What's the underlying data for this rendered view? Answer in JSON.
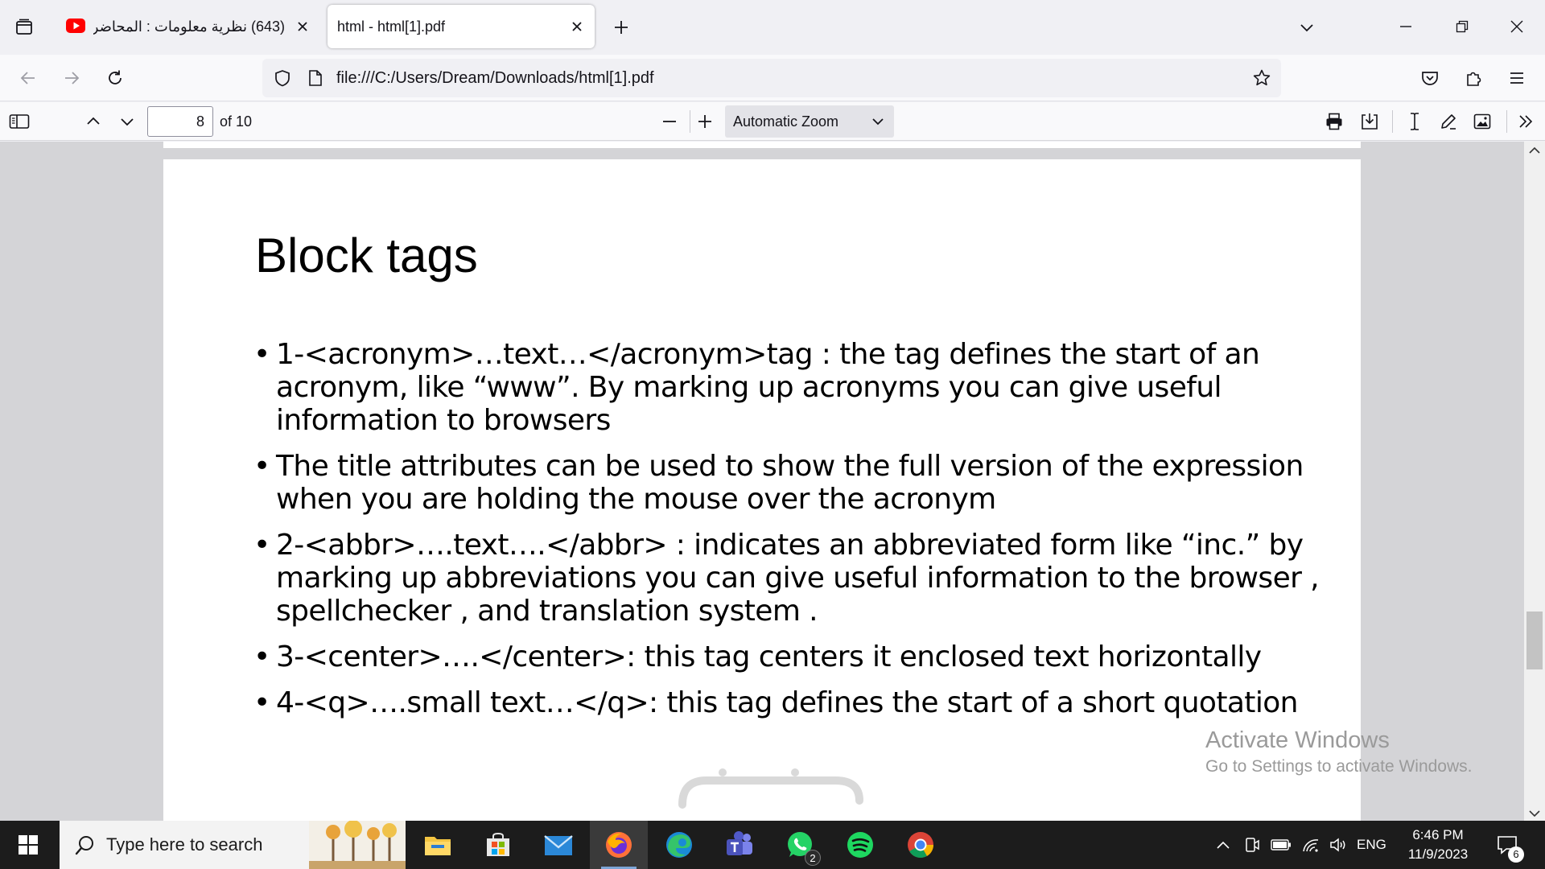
{
  "browser": {
    "tabs": [
      {
        "title": "(643) نظرية معلومات : المحاضرة",
        "favicon": "youtube-icon",
        "active": false
      },
      {
        "title": "html - html[1].pdf",
        "favicon": "",
        "active": true
      }
    ],
    "url": "file:///C:/Users/Dream/Downloads/html[1].pdf"
  },
  "pdf_toolbar": {
    "page_number": "8",
    "page_count": "of 10",
    "zoom": "Automatic Zoom"
  },
  "slide": {
    "title": "Block tags",
    "bullets": [
      "1-<acronym>…text…</acronym>tag : the tag defines the start of an acronym, like “www”. By marking up acronyms you can give useful information to browsers",
      "The title attributes can be used to show the full version of the expression when you are holding the mouse over the acronym",
      "2-<abbr>….text….</abbr> : indicates an abbreviated form like “inc.” by marking up abbreviations you can give useful information to the browser , spellchecker , and translation system .",
      "3-<center>….</center>: this tag centers it enclosed text horizontally",
      "4-<q>….small text…</q>: this tag defines the start of a short quotation"
    ]
  },
  "activation": {
    "title": "Activate Windows",
    "subtitle": "Go to Settings to activate Windows."
  },
  "taskbar": {
    "search_placeholder": "Type here to search",
    "apps": [
      "file-explorer-icon",
      "microsoft-store-icon",
      "mail-icon",
      "firefox-icon",
      "edge-icon",
      "teams-icon",
      "whatsapp-icon",
      "spotify-icon",
      "chrome-icon"
    ],
    "whatsapp_badge": "2",
    "language": "ENG",
    "time": "6:46 PM",
    "date": "11/9/2023",
    "notification_count": "6"
  },
  "colors": {
    "youtube_red": "#ff0000",
    "taskbar_bg": "#1c1c1c",
    "viewer_bg": "#d4d4d7"
  }
}
